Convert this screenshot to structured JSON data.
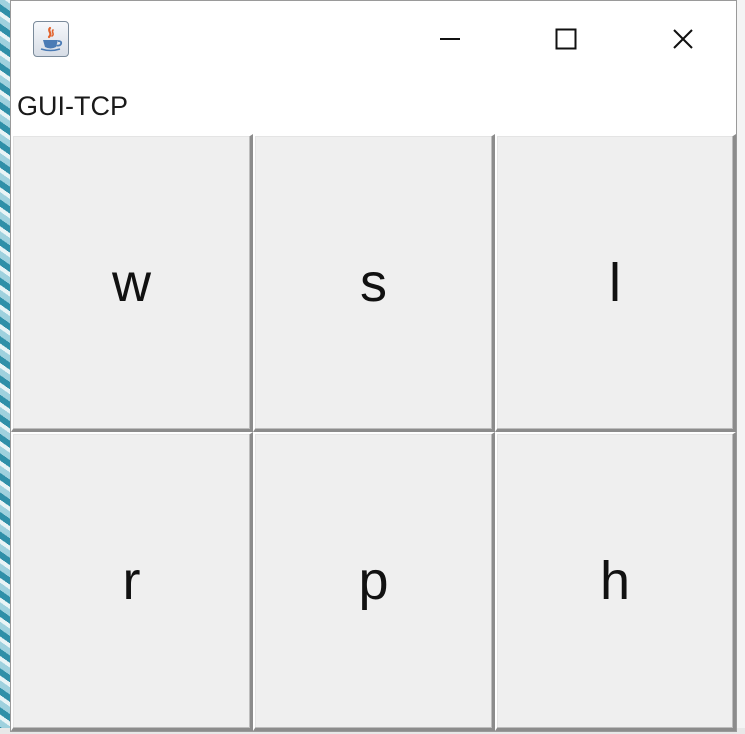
{
  "window": {
    "app_icon": "java-coffee-cup-icon",
    "controls": {
      "minimize_icon": "minimize-icon",
      "maximize_icon": "maximize-icon",
      "close_icon": "close-icon"
    }
  },
  "content": {
    "label": "GUI-TCP"
  },
  "keys": [
    "w",
    "s",
    "l",
    "r",
    "p",
    "h"
  ]
}
